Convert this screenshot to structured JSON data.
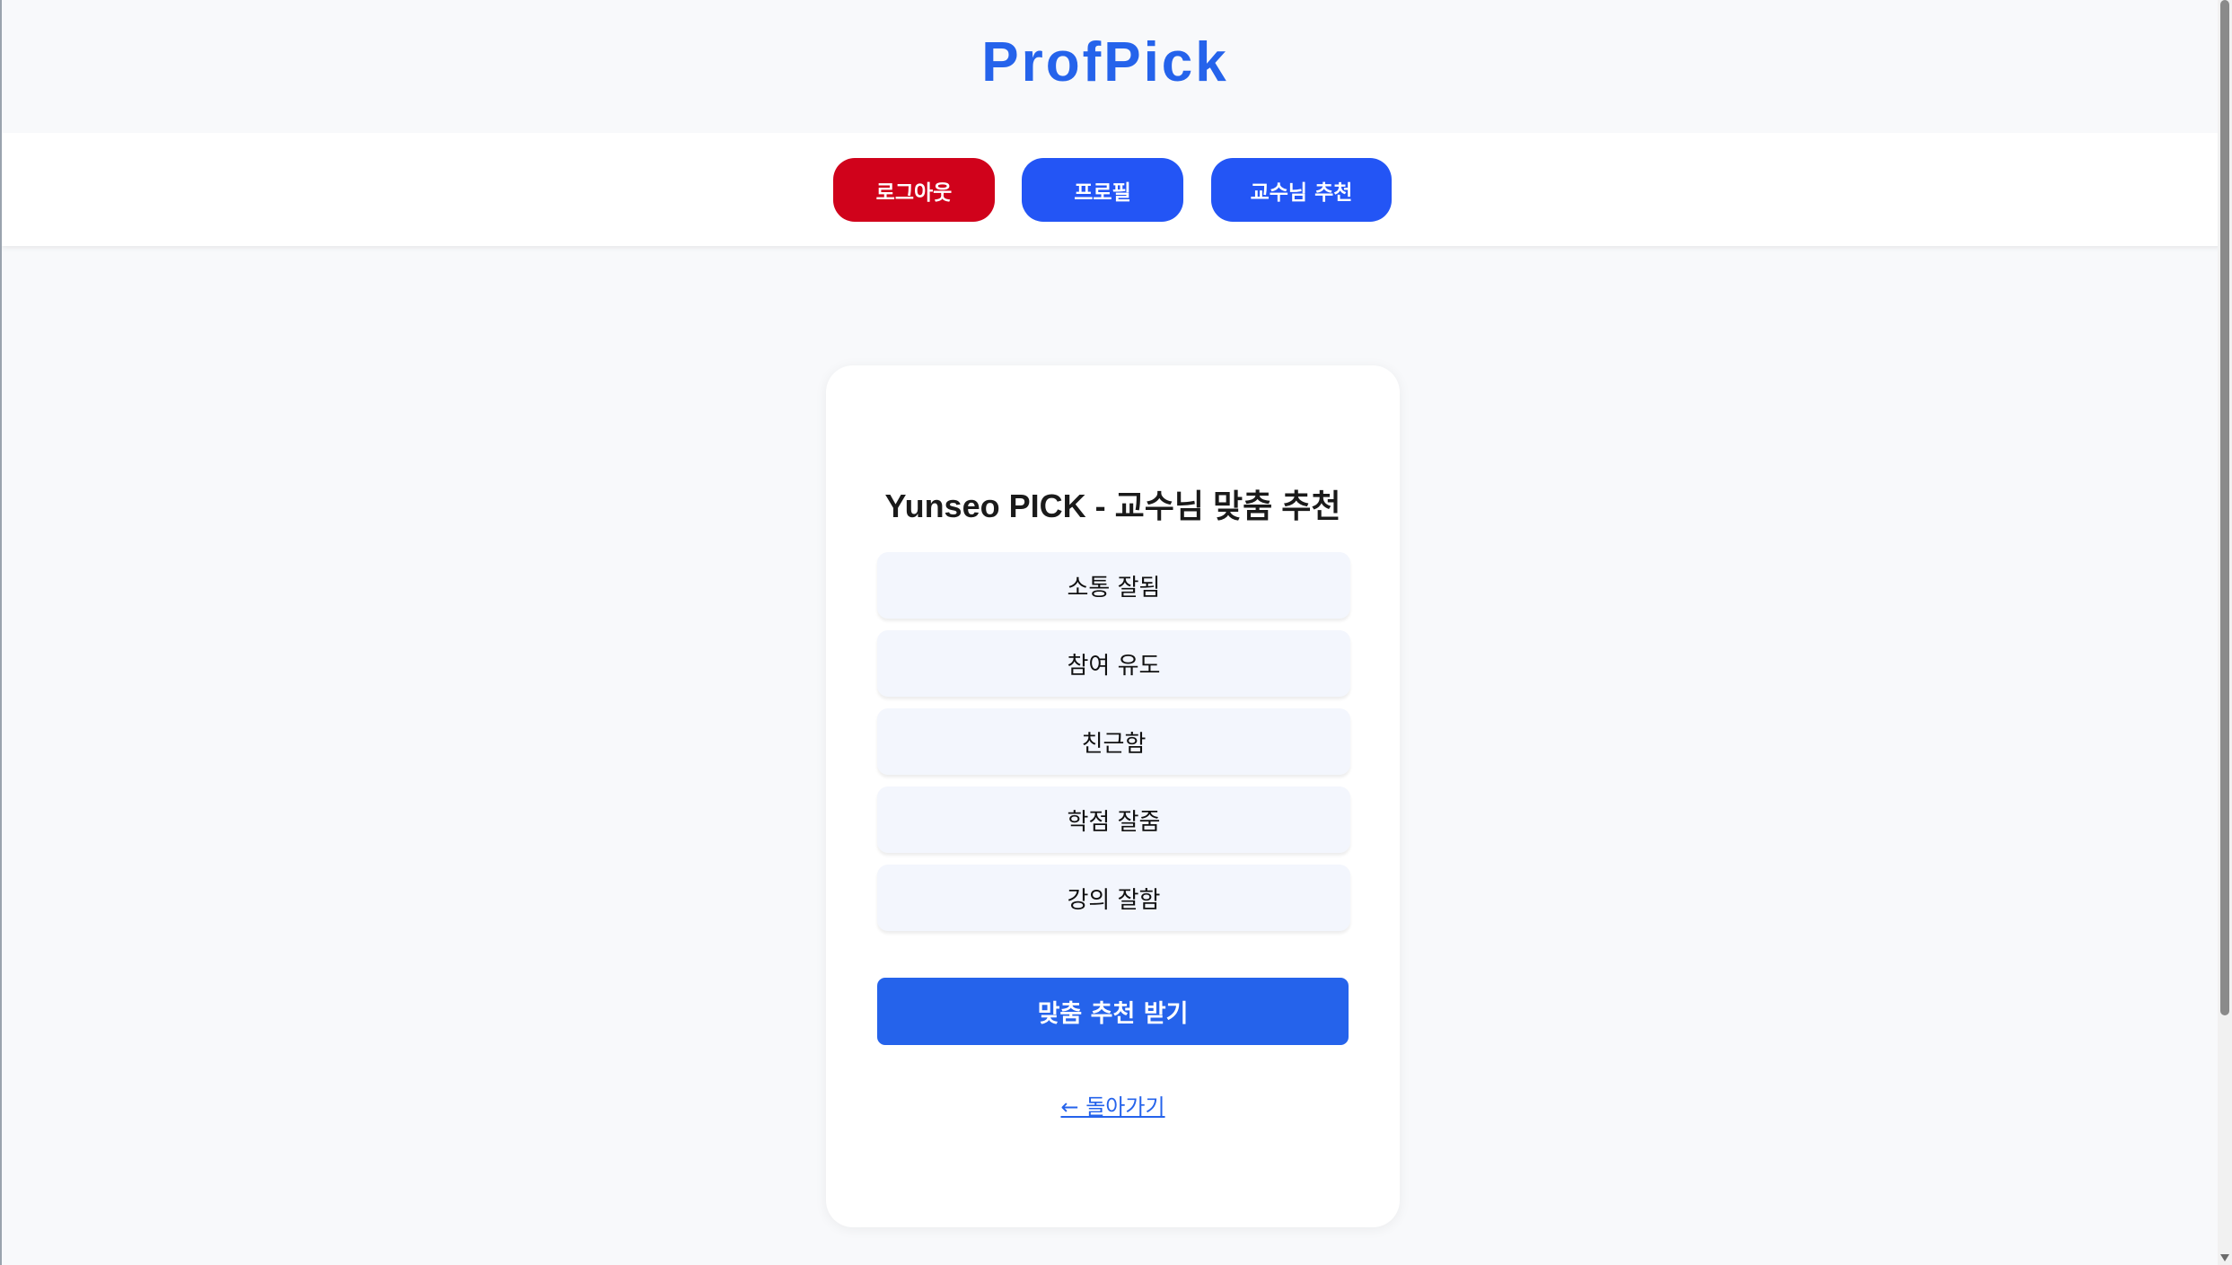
{
  "header": {
    "brand": "ProfPick"
  },
  "nav": {
    "logout_label": "로그아웃",
    "profile_label": "프로필",
    "recommend_label": "교수님 추천"
  },
  "card": {
    "title": "Yunseo PICK - 교수님 맞춤 추천",
    "options": [
      {
        "label": "소통 잘됨"
      },
      {
        "label": "참여 유도"
      },
      {
        "label": "친근함"
      },
      {
        "label": "학점 잘줌"
      },
      {
        "label": "강의 잘함"
      }
    ],
    "submit_label": "맞춤 추천 받기",
    "back_label": "← 돌아가기"
  },
  "colors": {
    "brand": "#2563eb",
    "logout": "#d0021b",
    "nav_button": "#2355f5",
    "option_bg": "#f3f6fd",
    "page_bg": "#f8f9fb"
  }
}
